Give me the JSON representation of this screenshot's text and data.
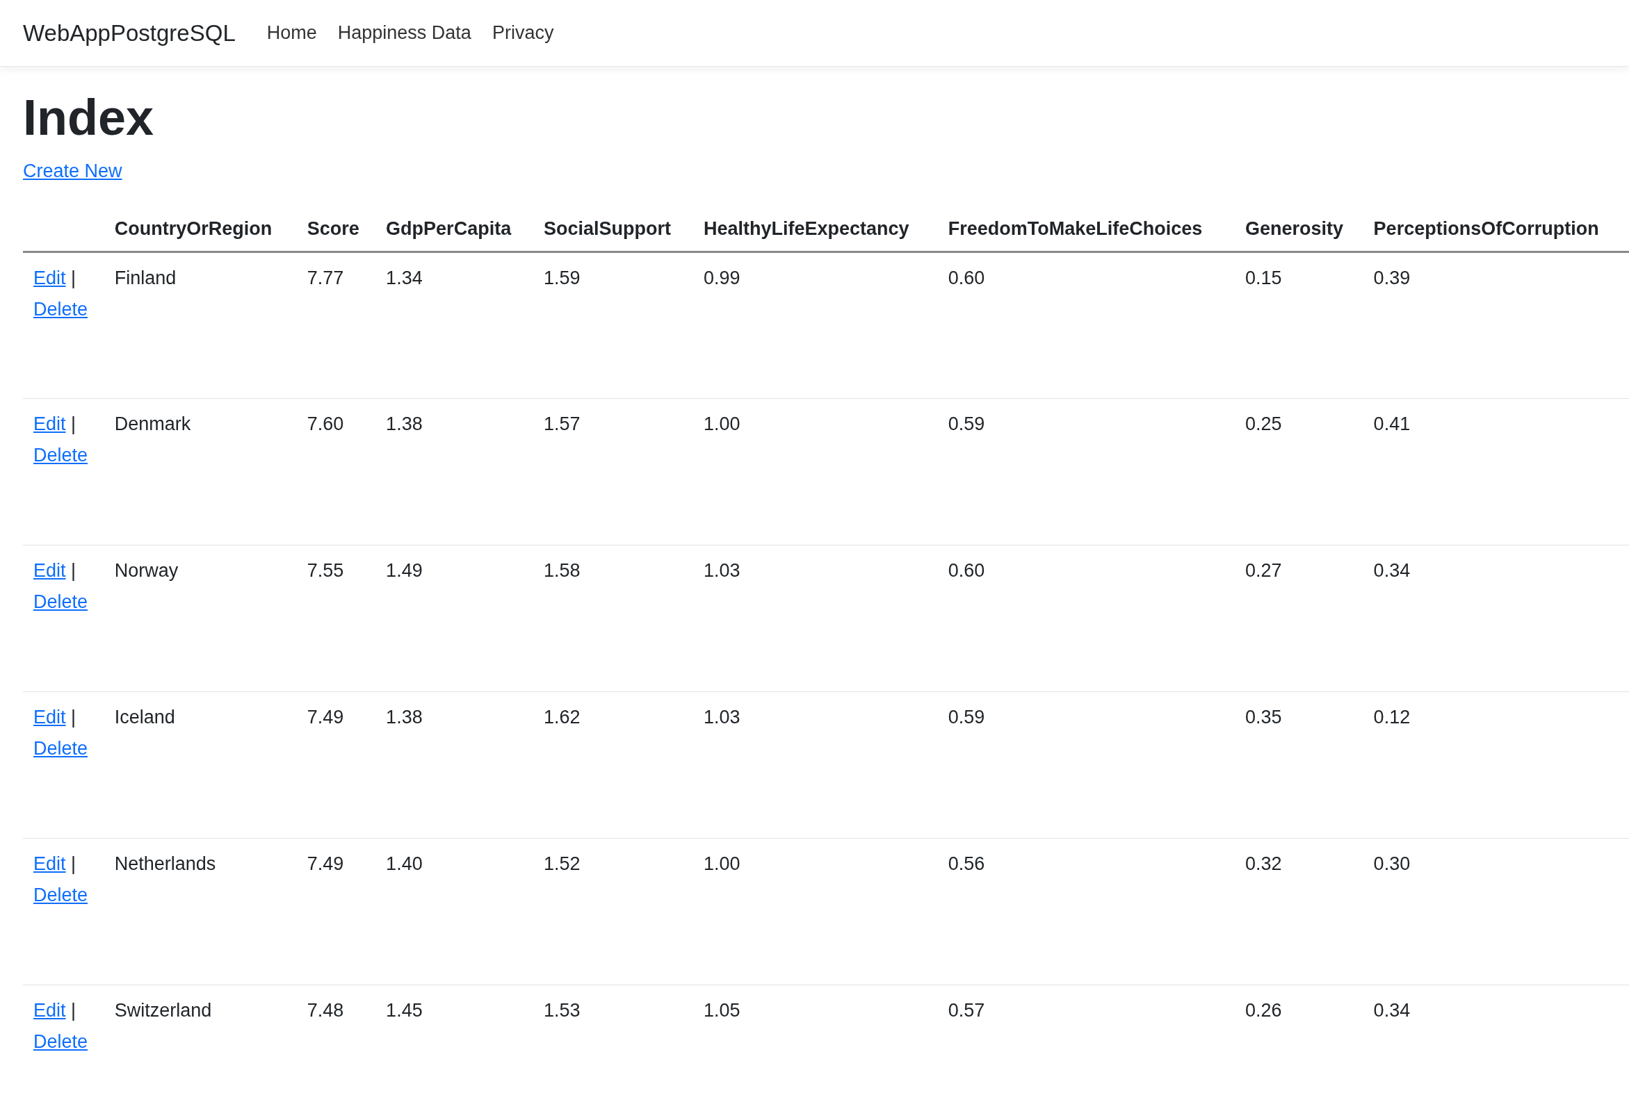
{
  "navbar": {
    "brand": "WebAppPostgreSQL",
    "links": [
      {
        "label": "Home"
      },
      {
        "label": "Happiness Data"
      },
      {
        "label": "Privacy"
      }
    ]
  },
  "heading": "Index",
  "create_link": "Create New",
  "table": {
    "columns": [
      "",
      "CountryOrRegion",
      "Score",
      "GdpPerCapita",
      "SocialSupport",
      "HealthyLifeExpectancy",
      "FreedomToMakeLifeChoices",
      "Generosity",
      "PerceptionsOfCorruption"
    ],
    "rows": [
      {
        "cells": [
          {
            "kind": "actions",
            "edit": "Edit",
            "separator": "|",
            "delete": "Delete"
          },
          "Finland",
          "7.77",
          "1.34",
          "1.59",
          "0.99",
          "0.60",
          "0.15",
          "0.39"
        ]
      },
      {
        "cells": [
          {
            "kind": "actions",
            "edit": "Edit",
            "separator": "|",
            "delete": "Delete"
          },
          "Denmark",
          "7.60",
          "1.38",
          "1.57",
          "1.00",
          "0.59",
          "0.25",
          "0.41"
        ]
      },
      {
        "cells": [
          {
            "kind": "actions",
            "edit": "Edit",
            "separator": "|",
            "delete": "Delete"
          },
          "Norway",
          "7.55",
          "1.49",
          "1.58",
          "1.03",
          "0.60",
          "0.27",
          "0.34"
        ]
      },
      {
        "cells": [
          {
            "kind": "actions",
            "edit": "Edit",
            "separator": "|",
            "delete": "Delete"
          },
          "Iceland",
          "7.49",
          "1.38",
          "1.62",
          "1.03",
          "0.59",
          "0.35",
          "0.12"
        ]
      },
      {
        "cells": [
          {
            "kind": "actions",
            "edit": "Edit",
            "separator": "|",
            "delete": "Delete"
          },
          "Netherlands",
          "7.49",
          "1.40",
          "1.52",
          "1.00",
          "0.56",
          "0.32",
          "0.30"
        ]
      },
      {
        "cells": [
          {
            "kind": "actions",
            "edit": "Edit",
            "separator": "|",
            "delete": "Delete"
          },
          "Switzerland",
          "7.48",
          "1.45",
          "1.53",
          "1.05",
          "0.57",
          "0.26",
          "0.34"
        ]
      }
    ]
  }
}
